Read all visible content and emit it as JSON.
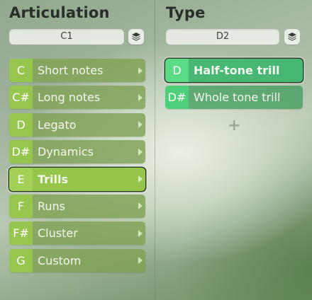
{
  "articulation": {
    "title": "Articulation",
    "key_value": "C1",
    "layers_icon": "layers-icon",
    "items": [
      {
        "key": "C",
        "label": "Short notes",
        "selected": false
      },
      {
        "key": "C#",
        "label": "Long notes",
        "selected": false
      },
      {
        "key": "D",
        "label": "Legato",
        "selected": false
      },
      {
        "key": "D#",
        "label": "Dynamics",
        "selected": false
      },
      {
        "key": "E",
        "label": "Trills",
        "selected": true
      },
      {
        "key": "F",
        "label": "Runs",
        "selected": false
      },
      {
        "key": "F#",
        "label": "Cluster",
        "selected": false
      },
      {
        "key": "G",
        "label": "Custom",
        "selected": false
      }
    ],
    "add_label": "+"
  },
  "type": {
    "title": "Type",
    "key_value": "D2",
    "layers_icon": "layers-icon",
    "items": [
      {
        "key": "D",
        "label": "Half-tone trill",
        "selected": true
      },
      {
        "key": "D#",
        "label": "Whole tone trill",
        "selected": false
      }
    ],
    "add_label": "+"
  },
  "colors": {
    "articulation_row": "#80a254",
    "articulation_key": "#97c64e",
    "type_row": "#48a060",
    "type_key": "#4ed07a",
    "selected_outline": "#2d3a26"
  }
}
